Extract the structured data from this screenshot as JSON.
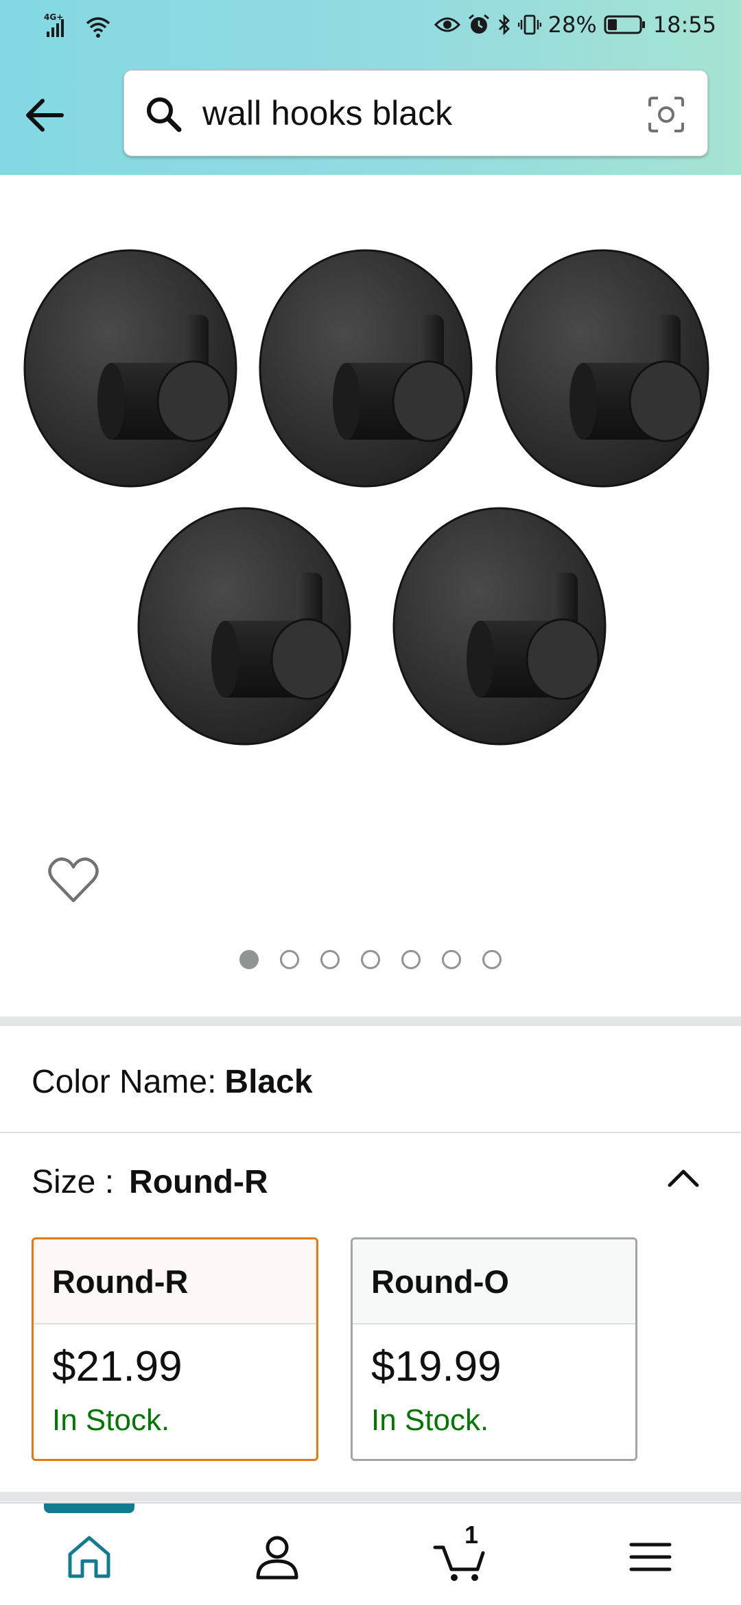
{
  "status_bar": {
    "network": "4G+",
    "battery": "28%",
    "time": "18:55",
    "icons": [
      "signal-icon",
      "wifi-icon",
      "eye-icon",
      "alarm-icon",
      "bluetooth-icon",
      "vibrate-icon",
      "battery-icon"
    ]
  },
  "header": {
    "back_icon": "arrow-left-icon",
    "search_query": "wall hooks black",
    "camera_icon": "camera-scan-icon"
  },
  "gallery": {
    "image": "black-round-wall-hooks-five-pack",
    "hooks_shown": 5,
    "dots_total": 7,
    "active_dot": 1,
    "wishlist_icon": "heart-outline-icon"
  },
  "variation": {
    "color_label": "Color Name:",
    "color_value": "Black",
    "size_label": "Size :",
    "size_value": "Round-R",
    "options": [
      {
        "name": "Round-R",
        "price": "$21.99",
        "stock": "In Stock.",
        "selected": true
      },
      {
        "name": "Round-O",
        "price": "$19.99",
        "stock": "In Stock.",
        "selected": false
      }
    ]
  },
  "bottom_nav": {
    "items": [
      "home-icon",
      "account-icon",
      "cart-icon",
      "menu-icon"
    ],
    "active": "home",
    "cart_count": "1"
  },
  "colors": {
    "header_gradient_start": "#84d8e3",
    "header_gradient_end": "#a6e3d2",
    "selected_border": "#e47911",
    "in_stock": "#007600",
    "nav_active": "#137b8f"
  }
}
